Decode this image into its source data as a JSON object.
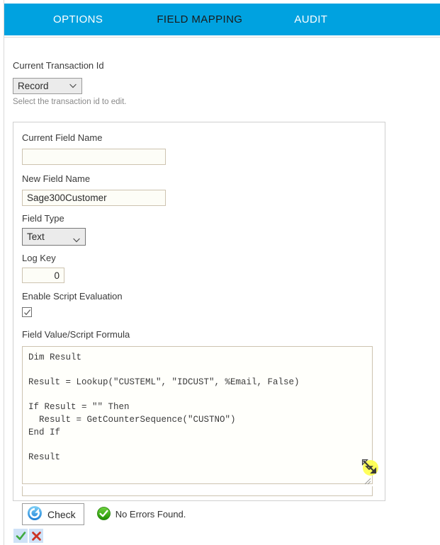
{
  "nav": {
    "tabs": [
      {
        "label": "OPTIONS",
        "active": false
      },
      {
        "label": "FIELD MAPPING",
        "active": true
      },
      {
        "label": "AUDIT",
        "active": false
      }
    ],
    "bar_color": "#00a2e0",
    "active_tab_color": "#1a1a1a",
    "inactive_tab_color": "#ffffff"
  },
  "transaction": {
    "label": "Current Transaction Id",
    "select_value": "Record",
    "select_options": [
      "Record"
    ],
    "help": "Select the transaction id to edit.",
    "chevron_icon": "chevron-down-icon"
  },
  "panel": {
    "current_field_name": {
      "label": "Current Field Name",
      "value": "",
      "placeholder": ""
    },
    "new_field_name": {
      "label": "New Field Name",
      "value": "Sage300Customer",
      "placeholder": ""
    },
    "field_type": {
      "label": "Field Type",
      "value": "Text",
      "options": [
        "Text"
      ],
      "chevron_icon": "chevron-down-icon"
    },
    "log_key": {
      "label": "Log Key",
      "value": "0"
    },
    "enable_script_evaluation": {
      "label": "Enable Script Evaluation",
      "checked": true,
      "icon": "checkmark-icon"
    },
    "script": {
      "label": "Field Value/Script Formula",
      "value": "Dim Result\n\nResult = Lookup(\"CUSTEML\", \"IDCUST\", %Email, False)\n\nIf Result = \"\" Then\n  Result = GetCounterSequence(\"CUSTNO\")\nEnd If\n\nResult",
      "resize_handle_icon": "resize-handle-icon"
    },
    "check_button": {
      "label": "Check",
      "icon": "refresh-icon"
    },
    "status": {
      "text": "No Errors Found.",
      "icon": "green-check-circle-icon",
      "color": "#22aa22"
    }
  },
  "bottom_actions": [
    {
      "name": "confirm",
      "icon": "green-checkmark-icon",
      "color": "#3faa3f"
    },
    {
      "name": "cancel",
      "icon": "red-cross-icon",
      "color": "#cc3322"
    }
  ],
  "cursor": {
    "icon": "resize-nwse-cursor",
    "highlight_color": "#ffff4d"
  }
}
